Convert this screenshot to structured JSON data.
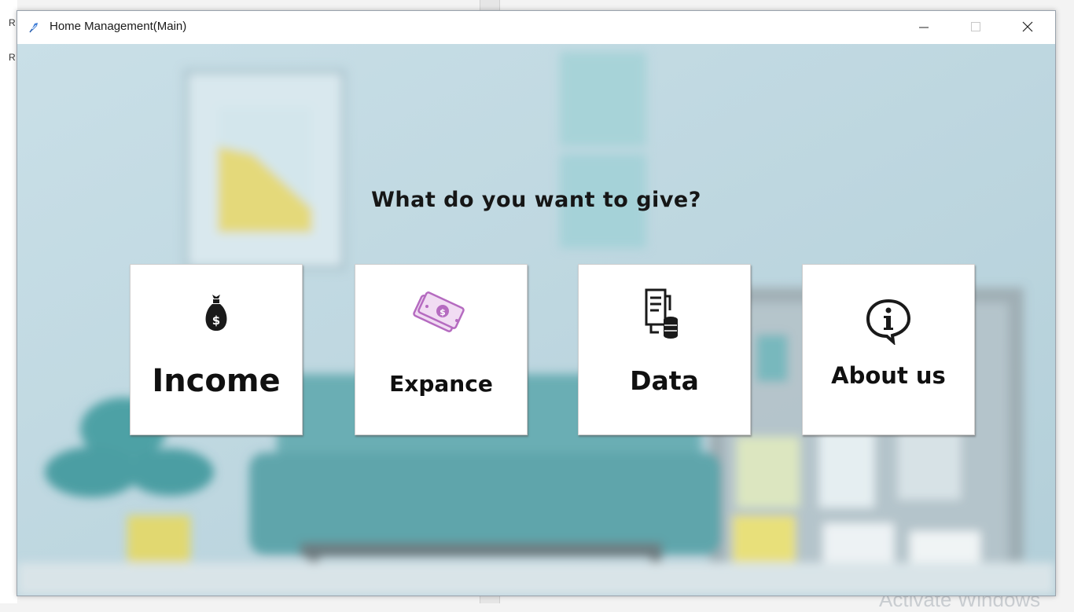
{
  "window": {
    "title": "Home Management(Main)"
  },
  "prompt": "What do you want to give?",
  "tiles": [
    {
      "label": "Income",
      "icon": "money-bag-icon"
    },
    {
      "label": "Expance",
      "icon": "cash-banknotes-icon"
    },
    {
      "label": "Data",
      "icon": "document-coins-icon"
    },
    {
      "label": "About us",
      "icon": "info-speech-bubble-icon"
    }
  ],
  "background": {
    "left_edge_chars": [
      "R",
      "R"
    ],
    "watermark": "Activate Windows"
  },
  "colors": {
    "scene_wall": "#bfd8e1",
    "sofa": "#6aaeb4",
    "expance_icon": "#b56bc0",
    "tile_text": "#101010"
  }
}
